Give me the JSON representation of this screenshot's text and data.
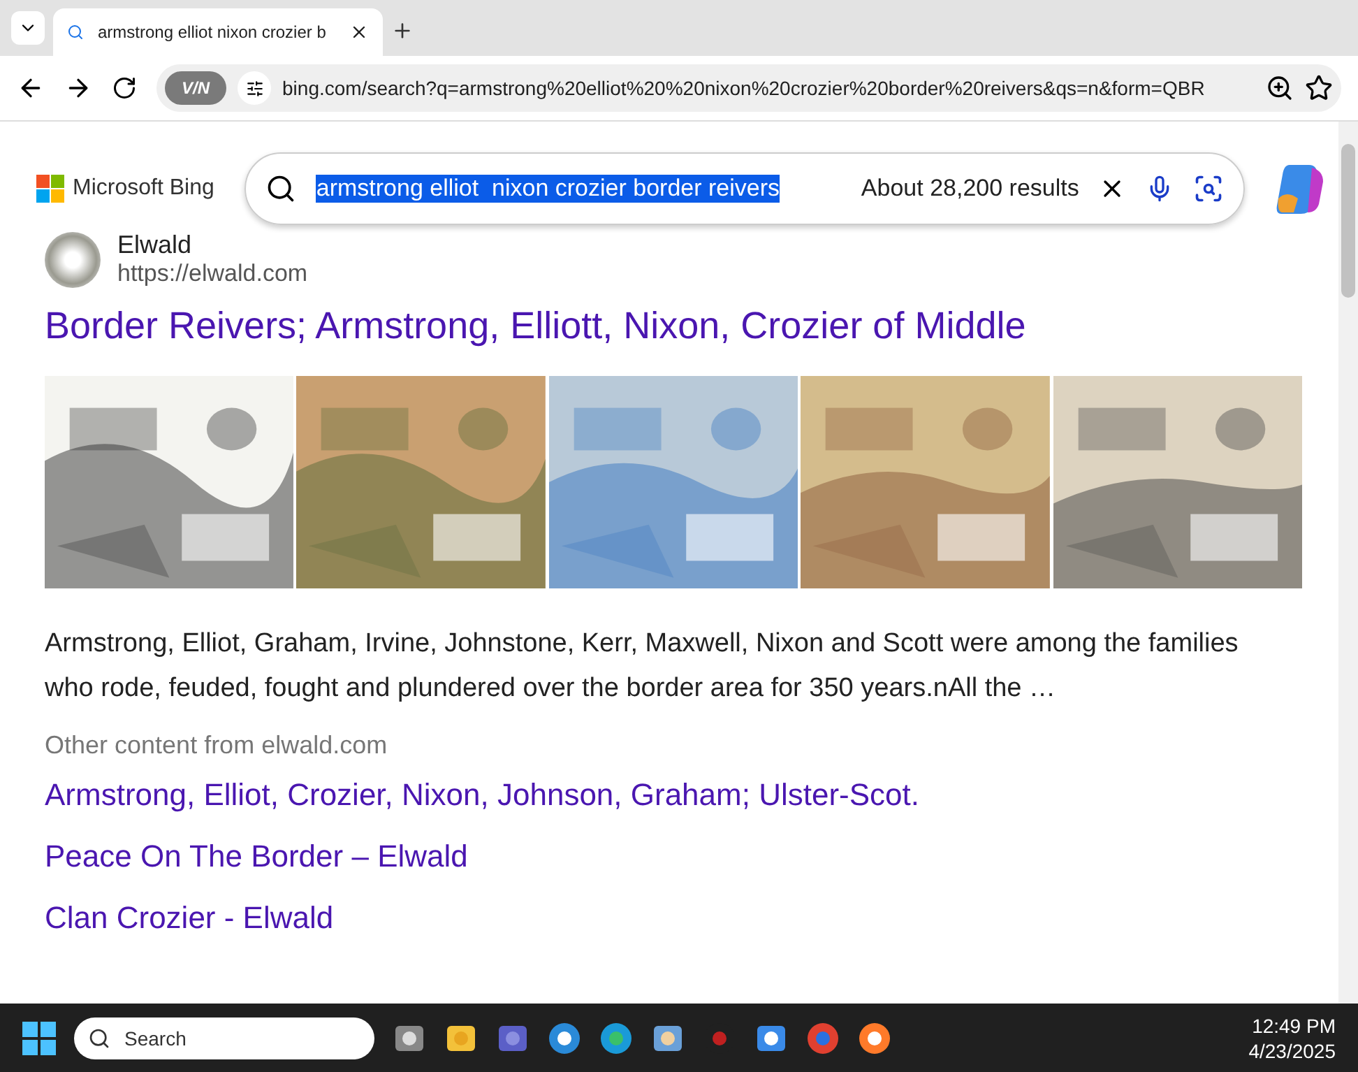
{
  "browser": {
    "tab": {
      "title": "armstrong elliot nixon crozier b",
      "selected": true
    },
    "address": "bing.com/search?q=armstrong%20elliot%20%20nixon%20crozier%20border%20reivers&qs=n&form=QBR",
    "vpn_badge": "V/N"
  },
  "header": {
    "logo": "Microsoft Bing",
    "query": "armstrong elliot  nixon crozier border reivers",
    "results_count": "About 28,200 results"
  },
  "result": {
    "site_name": "Elwald",
    "site_url": "https://elwald.com",
    "title": "Border Reivers; Armstrong, Elliott, Nixon, Crozier of Middle",
    "snippet": "Armstrong, Elliot, Graham, Irvine, Johnstone, Kerr, Maxwell, Nixon and Scott were among the families who rode, feuded, fought and plundered over the border area for 350 years.nAll the …",
    "other_heading": "Other content from elwald.com",
    "other_links": [
      "Armstrong, Elliot, Crozier, Nixon, Johnson, Graham; Ulster-Scot.",
      "Peace On The Border – Elwald",
      "Clan Crozier - Elwald"
    ]
  },
  "taskbar": {
    "search_placeholder": "Search",
    "time": "12:49 PM",
    "date": "4/23/2025"
  }
}
